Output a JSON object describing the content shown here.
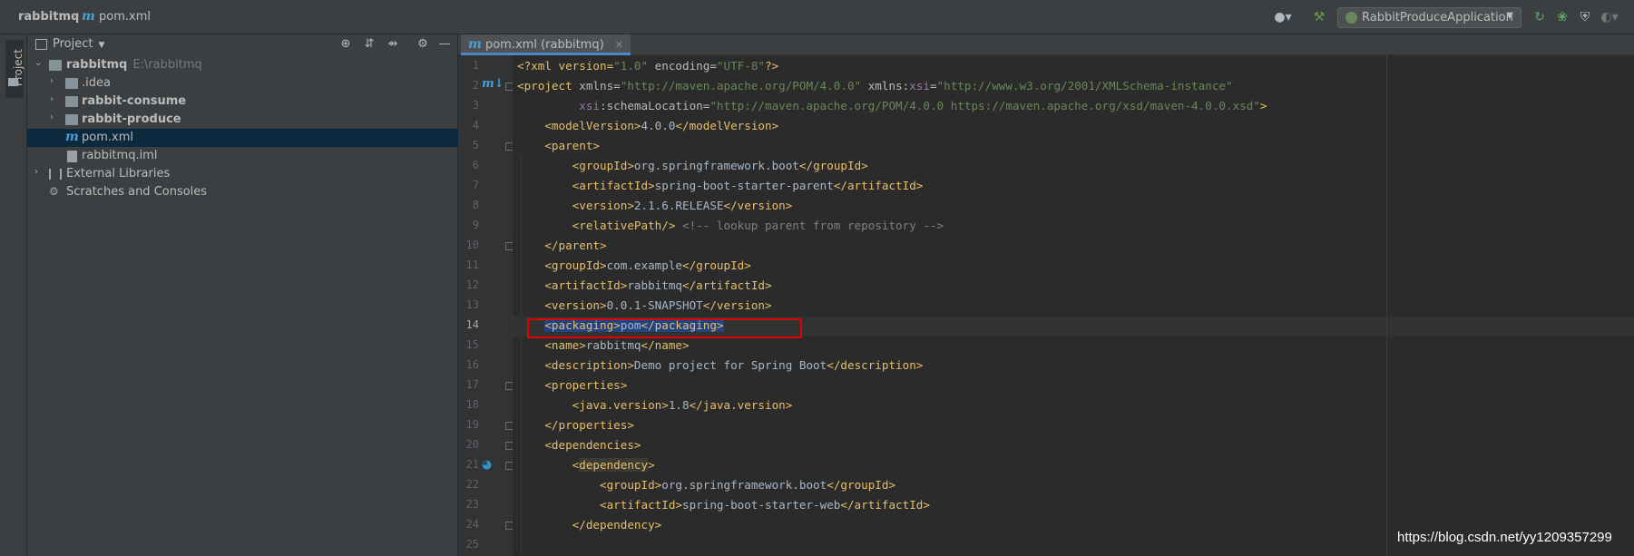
{
  "breadcrumb": {
    "project": "rabbitmq",
    "file": "pom.xml"
  },
  "run_config": {
    "label": "RabbitProduceApplication"
  },
  "left_strip": {
    "label": "Project"
  },
  "project_panel": {
    "title": "Project",
    "tree": [
      {
        "label": "rabbitmq",
        "path": "E:\\rabbitmq",
        "bold": true
      },
      {
        "label": ".idea"
      },
      {
        "label": "rabbit-consume",
        "bold": true
      },
      {
        "label": "rabbit-produce",
        "bold": true
      },
      {
        "label": "pom.xml",
        "selected": true
      },
      {
        "label": "rabbitmq.iml"
      },
      {
        "label": "External Libraries"
      },
      {
        "label": "Scratches and Consoles"
      }
    ]
  },
  "editor": {
    "tab_label": "pom.xml (rabbitmq)",
    "current_line": 14,
    "line_numbers": [
      "1",
      "2",
      "3",
      "4",
      "5",
      "6",
      "7",
      "8",
      "9",
      "10",
      "11",
      "12",
      "13",
      "14",
      "15",
      "16",
      "17",
      "18",
      "19",
      "20",
      "21",
      "22",
      "23",
      "24",
      "25"
    ]
  },
  "code": {
    "l1": {
      "a": "<?xml version=",
      "b": "\"1.0\"",
      "c": " encoding=",
      "d": "\"UTF-8\"",
      "e": "?>"
    },
    "l2": {
      "a": "<project ",
      "b": "xmlns=",
      "c": "\"http://maven.apache.org/POM/4.0.0\"",
      "d": " xmlns:",
      "e": "xsi",
      "f": "=",
      "g": "\"http://www.w3.org/2001/XMLSchema-instance\""
    },
    "l3": {
      "a": "xsi",
      "b": ":schemaLocation=",
      "c": "\"http://maven.apache.org/POM/4.0.0 https://maven.apache.org/xsd/maven-4.0.0.xsd\"",
      "d": ">"
    },
    "l4": {
      "o": "<modelVersion>",
      "t": "4.0.0",
      "c": "</modelVersion>"
    },
    "l5": {
      "o": "<parent>"
    },
    "l6": {
      "o": "<groupId>",
      "t": "org.springframework.boot",
      "c": "</groupId>"
    },
    "l7": {
      "o": "<artifactId>",
      "t": "spring-boot-starter-parent",
      "c": "</artifactId>"
    },
    "l8": {
      "o": "<version>",
      "t": "2.1.6.RELEASE",
      "c": "</version>"
    },
    "l9": {
      "o": "<relativePath/>",
      "com": " <!-- lookup parent from repository -->"
    },
    "l10": {
      "o": "</parent>"
    },
    "l11": {
      "o": "<groupId>",
      "t": "com.example",
      "c": "</groupId>"
    },
    "l12": {
      "o": "<artifactId>",
      "t": "rabbitmq",
      "c": "</artifactId>"
    },
    "l13": {
      "o": "<version>",
      "t": "0.0.1-SNAPSHOT",
      "c": "</version>"
    },
    "l14": {
      "o": "<packaging>",
      "t": "pom",
      "c": "</packaging>"
    },
    "l15": {
      "o": "<name>",
      "t": "rabbitmq",
      "c": "</name>"
    },
    "l16": {
      "o": "<description>",
      "t": "Demo project for Spring Boot",
      "c": "</description>"
    },
    "l17": {
      "o": "<properties>"
    },
    "l18": {
      "o": "<java.version>",
      "t": "1.8",
      "c": "</java.version>"
    },
    "l19": {
      "o": "</properties>"
    },
    "l20": {
      "o": "<dependencies>"
    },
    "l21": {
      "lt": "<",
      "n": "dependency",
      "gt": ">"
    },
    "l22": {
      "o": "<groupId>",
      "t": "org.springframework.boot",
      "c": "</groupId>"
    },
    "l23": {
      "o": "<artifactId>",
      "t": "spring-boot-starter-web",
      "c": "</artifactId>"
    },
    "l24": {
      "o": "</dependency>"
    }
  },
  "watermark": "https://blog.csdn.net/yy1209357299",
  "colors": {
    "tag": "#e8bf6a",
    "string": "#6a8759",
    "text": "#a9b7c6",
    "comment": "#808080",
    "selection": "#214283",
    "highlight_box": "#e00000"
  }
}
